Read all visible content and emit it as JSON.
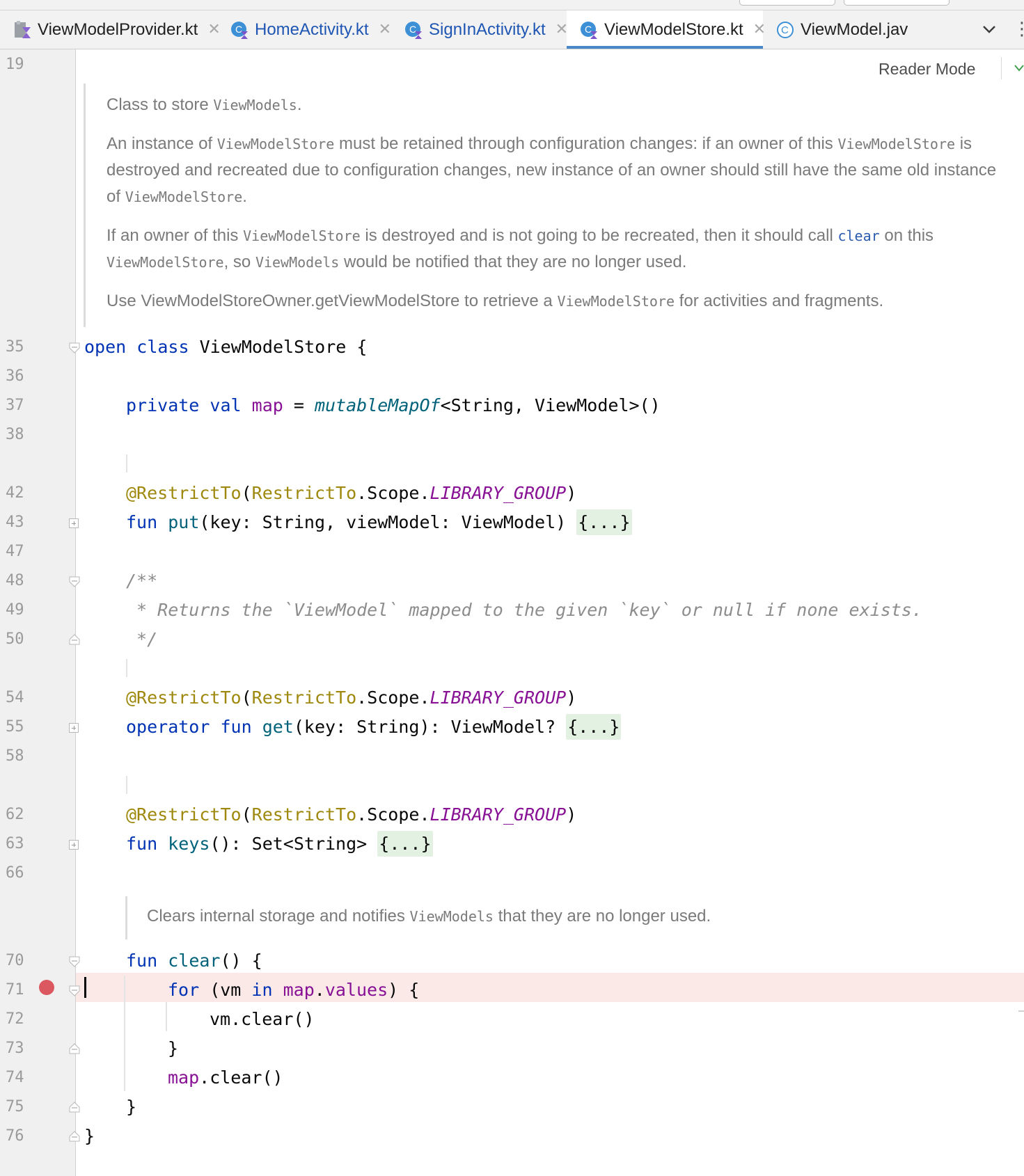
{
  "tabs": [
    {
      "label": "ViewModelProvider.kt",
      "icon": "kotlin-file-icon",
      "active": false,
      "close": "✕"
    },
    {
      "label": "HomeActivity.kt",
      "icon": "kotlin-class-icon",
      "active": false,
      "close": "✕"
    },
    {
      "label": "SignInActivity.kt",
      "icon": "kotlin-class-icon",
      "active": false,
      "close": "✕"
    },
    {
      "label": "ViewModelStore.kt",
      "icon": "kotlin-class-icon",
      "active": true,
      "close": "✕"
    },
    {
      "label": "ViewModel.jav",
      "icon": "java-class-icon",
      "active": false
    }
  ],
  "tab_overflow_icon": "chevron-down-icon",
  "editor": {
    "reader_mode": "Reader Mode",
    "doc1": {
      "p1_a": "Class to store ",
      "p1_code": "ViewModels",
      "p1_b": ".",
      "p2_a": "An instance of ",
      "p2_code1": "ViewModelStore",
      "p2_b": " must be retained through configuration changes: if an owner of this ",
      "p2_code2": "ViewModelStore",
      "p2_c": " is destroyed and recreated due to configuration changes, new instance of an owner should still have the same old instance of ",
      "p2_code3": "ViewModelStore",
      "p2_d": ".",
      "p3_a": "If an owner of this ",
      "p3_code1": "ViewModelStore",
      "p3_b": " is destroyed and is not going to be recreated, then it should call ",
      "p3_link": "clear",
      "p3_c": " on this ",
      "p3_code2": "ViewModelStore",
      "p3_d": ", so ",
      "p3_code3": "ViewModels",
      "p3_e": " would be notified that they are no longer used.",
      "p4_a": "Use ViewModelStoreOwner.getViewModelStore to retrieve a ",
      "p4_code": "ViewModelStore",
      "p4_b": " for activities and fragments."
    },
    "doc2": {
      "a": "Clears internal storage and notifies ",
      "code": "ViewModels",
      "b": " that they are no longer used."
    },
    "line_numbers": [
      "19",
      "35",
      "36",
      "37",
      "38",
      "42",
      "43",
      "47",
      "48",
      "49",
      "50",
      "54",
      "55",
      "58",
      "62",
      "63",
      "66",
      "70",
      "71",
      "72",
      "73",
      "74",
      "75",
      "76"
    ],
    "breakpoint_line": "71",
    "code": {
      "l35": {
        "kw1": "open",
        "kw2": "class",
        "name": "ViewModelStore",
        "brace": " {"
      },
      "l37": {
        "kw1": "private",
        "kw2": "val",
        "prop": "map",
        "eq": " = ",
        "fn": "mutableMapOf",
        "rest": "<String, ViewModel>()"
      },
      "annot": "@RestrictTo",
      "annot_arg1": "RestrictTo",
      "annot_arg2": ".Scope.",
      "annot_const": "LIBRARY_GROUP",
      "open_paren": "(",
      "close_paren": ")",
      "l43": {
        "kw": "fun",
        "fn": "put",
        "params": "(key: String, viewModel: ViewModel) ",
        "folded": "{...}"
      },
      "l48": "/**",
      "l49": " * Returns the `ViewModel` mapped to the given `key` or null if none exists.",
      "l50": " */",
      "l55": {
        "kw1": "operator",
        "kw2": "fun",
        "fn": "get",
        "params": "(key: String): ViewModel? ",
        "folded": "{...}"
      },
      "l63": {
        "kw": "fun",
        "fn": "keys",
        "params": "(): Set<String> ",
        "folded": "{...}"
      },
      "l70": {
        "kw": "fun",
        "fn": "clear",
        "rest": "() {"
      },
      "l71": {
        "kw1": "for",
        "a": " (vm ",
        "kw2": "in",
        "prop1": "map",
        "dot": ".",
        "prop2": "values",
        "b": ") {"
      },
      "l72": "vm.clear()",
      "l73": "}",
      "l74": {
        "prop": "map",
        "rest": ".clear()"
      },
      "l75": "}",
      "l76": "}"
    }
  },
  "colors": {
    "keyword": "#0033b3",
    "function": "#00627a",
    "property": "#871094",
    "annotation": "#9e880d",
    "comment": "#8c8c8c",
    "breakpoint": "#db5860",
    "tab_underline": "#4a88c7"
  }
}
